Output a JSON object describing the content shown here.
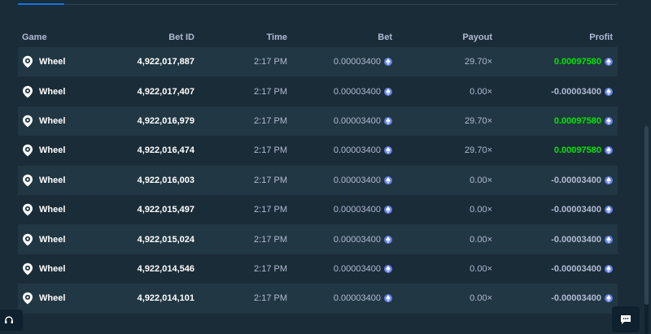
{
  "colors": {
    "accent": "#1475e1",
    "win": "#00e701",
    "muted": "#b1bad3",
    "row": "#213743",
    "coin": "#627eea"
  },
  "table": {
    "headers": {
      "game": "Game",
      "bet_id": "Bet ID",
      "time": "Time",
      "bet": "Bet",
      "payout": "Payout",
      "profit": "Profit"
    },
    "rows": [
      {
        "game": "Wheel",
        "bet_id": "4,922,017,887",
        "time": "2:17 PM",
        "bet": "0.00003400",
        "payout": "29.70×",
        "profit": "0.00097580",
        "win": true
      },
      {
        "game": "Wheel",
        "bet_id": "4,922,017,407",
        "time": "2:17 PM",
        "bet": "0.00003400",
        "payout": "0.00×",
        "profit": "-0.00003400",
        "win": false
      },
      {
        "game": "Wheel",
        "bet_id": "4,922,016,979",
        "time": "2:17 PM",
        "bet": "0.00003400",
        "payout": "29.70×",
        "profit": "0.00097580",
        "win": true
      },
      {
        "game": "Wheel",
        "bet_id": "4,922,016,474",
        "time": "2:17 PM",
        "bet": "0.00003400",
        "payout": "29.70×",
        "profit": "0.00097580",
        "win": true
      },
      {
        "game": "Wheel",
        "bet_id": "4,922,016,003",
        "time": "2:17 PM",
        "bet": "0.00003400",
        "payout": "0.00×",
        "profit": "-0.00003400",
        "win": false
      },
      {
        "game": "Wheel",
        "bet_id": "4,922,015,497",
        "time": "2:17 PM",
        "bet": "0.00003400",
        "payout": "0.00×",
        "profit": "-0.00003400",
        "win": false
      },
      {
        "game": "Wheel",
        "bet_id": "4,922,015,024",
        "time": "2:17 PM",
        "bet": "0.00003400",
        "payout": "0.00×",
        "profit": "-0.00003400",
        "win": false
      },
      {
        "game": "Wheel",
        "bet_id": "4,922,014,546",
        "time": "2:17 PM",
        "bet": "0.00003400",
        "payout": "0.00×",
        "profit": "-0.00003400",
        "win": false
      },
      {
        "game": "Wheel",
        "bet_id": "4,922,014,101",
        "time": "2:17 PM",
        "bet": "0.00003400",
        "payout": "0.00×",
        "profit": "-0.00003400",
        "win": false
      }
    ]
  },
  "icons": {
    "game": "wheel-pin-icon",
    "currency": "ethereum-icon",
    "support": "headset-icon",
    "chat": "chat-icon"
  }
}
